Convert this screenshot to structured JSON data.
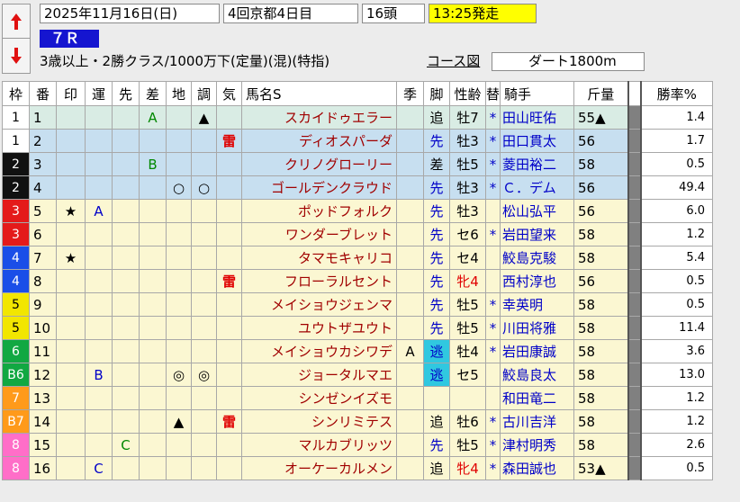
{
  "header": {
    "date": "2025年11月16日(日)",
    "meeting": "4回京都4日目",
    "runners": "16頭",
    "start_time": "13:25発走",
    "race_number": "７Ｒ",
    "conditions": "3歳以上・2勝クラス/1000万下(定量)(混)(特指)",
    "course_link": "コース図",
    "course": "ダート1800m",
    "colors": {
      "start_time_bg": "#ffff00",
      "race_bg": "#1515d0"
    }
  },
  "columns": [
    "枠",
    "番",
    "印",
    "運",
    "先",
    "差",
    "地",
    "調",
    "気",
    "馬名S",
    "季",
    "脚",
    "性齢",
    "替",
    "騎手",
    "斤量",
    "",
    "勝率%"
  ],
  "rows": [
    {
      "waku": "1",
      "num": "1",
      "mark": "",
      "un": "",
      "saki": "",
      "sa": "A",
      "ji": "",
      "cho": "▲",
      "ki": "",
      "name": "スカイドゥエラー",
      "kisetsu": "",
      "kyaku": "追",
      "sexage": "牡7",
      "sexred": false,
      "kae": "*",
      "jockey": "田山旺佑",
      "weight": "55▲",
      "odds": "1.4"
    },
    {
      "waku": "1",
      "num": "2",
      "mark": "",
      "un": "",
      "saki": "",
      "sa": "",
      "ji": "",
      "cho": "",
      "ki": "雷",
      "name": "ディオスパーダ",
      "kisetsu": "",
      "kyaku": "先",
      "sexage": "牡3",
      "sexred": false,
      "kae": "*",
      "jockey": "田口貫太",
      "weight": "56",
      "odds": "1.7"
    },
    {
      "waku": "2",
      "num": "3",
      "mark": "",
      "un": "",
      "saki": "",
      "sa": "B",
      "ji": "",
      "cho": "",
      "ki": "",
      "name": "クリノグローリー",
      "kisetsu": "",
      "kyaku": "差",
      "sexage": "牡5",
      "sexred": false,
      "kae": "*",
      "jockey": "菱田裕二",
      "weight": "58",
      "odds": "0.5"
    },
    {
      "waku": "2",
      "num": "4",
      "mark": "",
      "un": "",
      "saki": "",
      "sa": "",
      "ji": "○",
      "cho": "○",
      "ki": "",
      "name": "ゴールデンクラウド",
      "kisetsu": "",
      "kyaku": "先",
      "sexage": "牡3",
      "sexred": false,
      "kae": "*",
      "jockey": "Ｃ．デム",
      "weight": "56",
      "odds": "49.4"
    },
    {
      "waku": "3",
      "num": "5",
      "mark": "★",
      "un": "A",
      "saki": "",
      "sa": "",
      "ji": "",
      "cho": "",
      "ki": "",
      "name": "ポッドフォルク",
      "kisetsu": "",
      "kyaku": "先",
      "sexage": "牡3",
      "sexred": false,
      "kae": "",
      "jockey": "松山弘平",
      "weight": "56",
      "odds": "6.0"
    },
    {
      "waku": "3",
      "num": "6",
      "mark": "",
      "un": "",
      "saki": "",
      "sa": "",
      "ji": "",
      "cho": "",
      "ki": "",
      "name": "ワンダーブレット",
      "kisetsu": "",
      "kyaku": "先",
      "sexage": "セ6",
      "sexred": false,
      "kae": "*",
      "jockey": "岩田望来",
      "weight": "58",
      "odds": "1.2"
    },
    {
      "waku": "4",
      "num": "7",
      "mark": "★",
      "un": "",
      "saki": "",
      "sa": "",
      "ji": "",
      "cho": "",
      "ki": "",
      "name": "タマモキャリコ",
      "kisetsu": "",
      "kyaku": "先",
      "sexage": "セ4",
      "sexred": false,
      "kae": "",
      "jockey": "鮫島克駿",
      "weight": "58",
      "odds": "5.4"
    },
    {
      "waku": "4",
      "num": "8",
      "mark": "",
      "un": "",
      "saki": "",
      "sa": "",
      "ji": "",
      "cho": "",
      "ki": "雷",
      "name": "フローラルセント",
      "kisetsu": "",
      "kyaku": "先",
      "sexage": "牝4",
      "sexred": true,
      "kae": "",
      "jockey": "西村淳也",
      "weight": "56",
      "odds": "0.5"
    },
    {
      "waku": "5",
      "num": "9",
      "mark": "",
      "un": "",
      "saki": "",
      "sa": "",
      "ji": "",
      "cho": "",
      "ki": "",
      "name": "メイショウジェンマ",
      "kisetsu": "",
      "kyaku": "先",
      "sexage": "牡5",
      "sexred": false,
      "kae": "*",
      "jockey": "幸英明",
      "weight": "58",
      "odds": "0.5"
    },
    {
      "waku": "5",
      "num": "10",
      "mark": "",
      "un": "",
      "saki": "",
      "sa": "",
      "ji": "",
      "cho": "",
      "ki": "",
      "name": "ユウトザユウト",
      "kisetsu": "",
      "kyaku": "先",
      "sexage": "牡5",
      "sexred": false,
      "kae": "*",
      "jockey": "川田将雅",
      "weight": "58",
      "odds": "11.4"
    },
    {
      "waku": "6",
      "num": "11",
      "mark": "",
      "un": "",
      "saki": "",
      "sa": "",
      "ji": "",
      "cho": "",
      "ki": "",
      "name": "メイショウカシワデ",
      "kisetsu": "A",
      "kyaku": "逃",
      "sexage": "牡4",
      "sexred": false,
      "kae": "*",
      "jockey": "岩田康誠",
      "weight": "58",
      "odds": "3.6"
    },
    {
      "waku": "B6",
      "num": "12",
      "mark": "",
      "un": "B",
      "saki": "",
      "sa": "",
      "ji": "◎",
      "cho": "◎",
      "ki": "",
      "name": "ジョータルマエ",
      "kisetsu": "",
      "kyaku": "逃",
      "sexage": "セ5",
      "sexred": false,
      "kae": "",
      "jockey": "鮫島良太",
      "weight": "58",
      "odds": "13.0"
    },
    {
      "waku": "7",
      "num": "13",
      "mark": "",
      "un": "",
      "saki": "",
      "sa": "",
      "ji": "",
      "cho": "",
      "ki": "",
      "name": "シンゼンイズモ",
      "kisetsu": "",
      "kyaku": "",
      "sexage": "",
      "sexred": false,
      "kae": "",
      "jockey": "和田竜二",
      "weight": "58",
      "odds": "1.2"
    },
    {
      "waku": "B7",
      "num": "14",
      "mark": "",
      "un": "",
      "saki": "",
      "sa": "",
      "ji": "▲",
      "cho": "",
      "ki": "雷",
      "name": "シンリミテス",
      "kisetsu": "",
      "kyaku": "追",
      "sexage": "牡6",
      "sexred": false,
      "kae": "*",
      "jockey": "古川吉洋",
      "weight": "58",
      "odds": "1.2"
    },
    {
      "waku": "8",
      "num": "15",
      "mark": "",
      "un": "",
      "saki": "C",
      "sa": "",
      "ji": "",
      "cho": "",
      "ki": "",
      "name": "マルカブリッツ",
      "kisetsu": "",
      "kyaku": "先",
      "sexage": "牡5",
      "sexred": false,
      "kae": "*",
      "jockey": "津村明秀",
      "weight": "58",
      "odds": "2.6"
    },
    {
      "waku": "8",
      "num": "16",
      "mark": "",
      "un": "C",
      "saki": "",
      "sa": "",
      "ji": "",
      "cho": "",
      "ki": "",
      "name": "オーケーカルメン",
      "kisetsu": "",
      "kyaku": "追",
      "sexage": "牝4",
      "sexred": true,
      "kae": "*",
      "jockey": "森田誠也",
      "weight": "53▲",
      "odds": "0.5"
    }
  ],
  "waku_colors": {
    "1": "#ffffff",
    "2": "#111111",
    "3": "#e41a1a",
    "4": "#1a4ee8",
    "5": "#f2e600",
    "6": "#11a842",
    "7": "#ff9a1a",
    "8": "#ff6ec8"
  }
}
